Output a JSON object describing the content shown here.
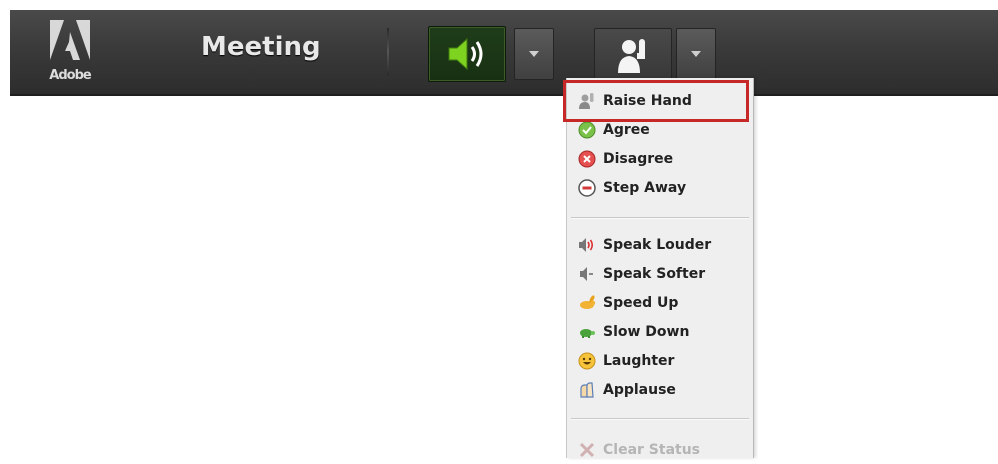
{
  "toolbar": {
    "logo_text": "Adobe",
    "title": "Meeting"
  },
  "menu": {
    "status_items": [
      {
        "label": "Raise Hand",
        "icon": "raise-hand-icon"
      },
      {
        "label": "Agree",
        "icon": "agree-check-icon"
      },
      {
        "label": "Disagree",
        "icon": "disagree-x-icon"
      },
      {
        "label": "Step Away",
        "icon": "step-away-icon"
      }
    ],
    "feedback_items": [
      {
        "label": "Speak Louder",
        "icon": "speak-louder-icon"
      },
      {
        "label": "Speak Softer",
        "icon": "speak-softer-icon"
      },
      {
        "label": "Speed Up",
        "icon": "speed-up-rabbit-icon"
      },
      {
        "label": "Slow Down",
        "icon": "slow-down-turtle-icon"
      },
      {
        "label": "Laughter",
        "icon": "laughter-smiley-icon"
      },
      {
        "label": "Applause",
        "icon": "applause-hands-icon"
      }
    ],
    "clear_status": {
      "label": "Clear Status",
      "icon": "clear-status-icon"
    }
  },
  "colors": {
    "toolbar_bg": "#3a3a3a",
    "audio_active": "#1f3d1a",
    "highlight": "#c62828",
    "menu_bg": "#efefef"
  }
}
